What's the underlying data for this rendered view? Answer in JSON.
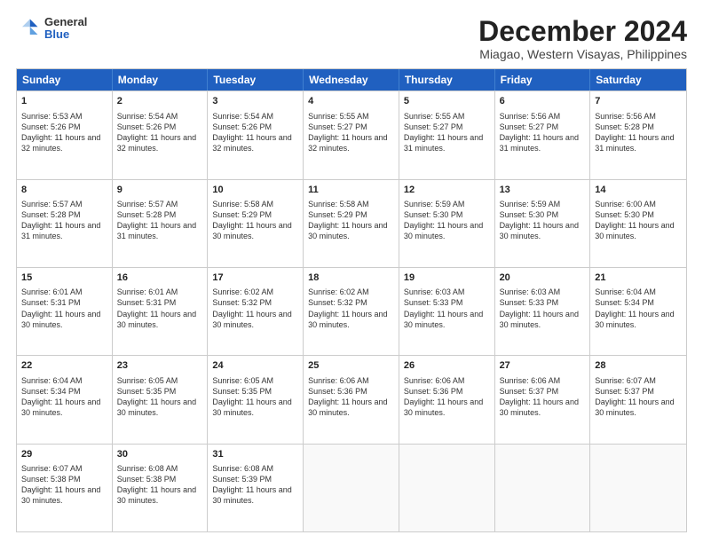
{
  "logo": {
    "general": "General",
    "blue": "Blue"
  },
  "title": "December 2024",
  "subtitle": "Miagao, Western Visayas, Philippines",
  "header_days": [
    "Sunday",
    "Monday",
    "Tuesday",
    "Wednesday",
    "Thursday",
    "Friday",
    "Saturday"
  ],
  "rows": [
    [
      {
        "day": "",
        "empty": true
      },
      {
        "day": "1",
        "sunrise": "Sunrise: 5:53 AM",
        "sunset": "Sunset: 5:26 PM",
        "daylight": "Daylight: 11 hours and 32 minutes."
      },
      {
        "day": "2",
        "sunrise": "Sunrise: 5:54 AM",
        "sunset": "Sunset: 5:26 PM",
        "daylight": "Daylight: 11 hours and 32 minutes."
      },
      {
        "day": "3",
        "sunrise": "Sunrise: 5:54 AM",
        "sunset": "Sunset: 5:26 PM",
        "daylight": "Daylight: 11 hours and 32 minutes."
      },
      {
        "day": "4",
        "sunrise": "Sunrise: 5:55 AM",
        "sunset": "Sunset: 5:27 PM",
        "daylight": "Daylight: 11 hours and 32 minutes."
      },
      {
        "day": "5",
        "sunrise": "Sunrise: 5:55 AM",
        "sunset": "Sunset: 5:27 PM",
        "daylight": "Daylight: 11 hours and 31 minutes."
      },
      {
        "day": "6",
        "sunrise": "Sunrise: 5:56 AM",
        "sunset": "Sunset: 5:27 PM",
        "daylight": "Daylight: 11 hours and 31 minutes."
      },
      {
        "day": "7",
        "sunrise": "Sunrise: 5:56 AM",
        "sunset": "Sunset: 5:28 PM",
        "daylight": "Daylight: 11 hours and 31 minutes."
      }
    ],
    [
      {
        "day": "8",
        "sunrise": "Sunrise: 5:57 AM",
        "sunset": "Sunset: 5:28 PM",
        "daylight": "Daylight: 11 hours and 31 minutes."
      },
      {
        "day": "9",
        "sunrise": "Sunrise: 5:57 AM",
        "sunset": "Sunset: 5:28 PM",
        "daylight": "Daylight: 11 hours and 31 minutes."
      },
      {
        "day": "10",
        "sunrise": "Sunrise: 5:58 AM",
        "sunset": "Sunset: 5:29 PM",
        "daylight": "Daylight: 11 hours and 30 minutes."
      },
      {
        "day": "11",
        "sunrise": "Sunrise: 5:58 AM",
        "sunset": "Sunset: 5:29 PM",
        "daylight": "Daylight: 11 hours and 30 minutes."
      },
      {
        "day": "12",
        "sunrise": "Sunrise: 5:59 AM",
        "sunset": "Sunset: 5:30 PM",
        "daylight": "Daylight: 11 hours and 30 minutes."
      },
      {
        "day": "13",
        "sunrise": "Sunrise: 5:59 AM",
        "sunset": "Sunset: 5:30 PM",
        "daylight": "Daylight: 11 hours and 30 minutes."
      },
      {
        "day": "14",
        "sunrise": "Sunrise: 6:00 AM",
        "sunset": "Sunset: 5:30 PM",
        "daylight": "Daylight: 11 hours and 30 minutes."
      }
    ],
    [
      {
        "day": "15",
        "sunrise": "Sunrise: 6:01 AM",
        "sunset": "Sunset: 5:31 PM",
        "daylight": "Daylight: 11 hours and 30 minutes."
      },
      {
        "day": "16",
        "sunrise": "Sunrise: 6:01 AM",
        "sunset": "Sunset: 5:31 PM",
        "daylight": "Daylight: 11 hours and 30 minutes."
      },
      {
        "day": "17",
        "sunrise": "Sunrise: 6:02 AM",
        "sunset": "Sunset: 5:32 PM",
        "daylight": "Daylight: 11 hours and 30 minutes."
      },
      {
        "day": "18",
        "sunrise": "Sunrise: 6:02 AM",
        "sunset": "Sunset: 5:32 PM",
        "daylight": "Daylight: 11 hours and 30 minutes."
      },
      {
        "day": "19",
        "sunrise": "Sunrise: 6:03 AM",
        "sunset": "Sunset: 5:33 PM",
        "daylight": "Daylight: 11 hours and 30 minutes."
      },
      {
        "day": "20",
        "sunrise": "Sunrise: 6:03 AM",
        "sunset": "Sunset: 5:33 PM",
        "daylight": "Daylight: 11 hours and 30 minutes."
      },
      {
        "day": "21",
        "sunrise": "Sunrise: 6:04 AM",
        "sunset": "Sunset: 5:34 PM",
        "daylight": "Daylight: 11 hours and 30 minutes."
      }
    ],
    [
      {
        "day": "22",
        "sunrise": "Sunrise: 6:04 AM",
        "sunset": "Sunset: 5:34 PM",
        "daylight": "Daylight: 11 hours and 30 minutes."
      },
      {
        "day": "23",
        "sunrise": "Sunrise: 6:05 AM",
        "sunset": "Sunset: 5:35 PM",
        "daylight": "Daylight: 11 hours and 30 minutes."
      },
      {
        "day": "24",
        "sunrise": "Sunrise: 6:05 AM",
        "sunset": "Sunset: 5:35 PM",
        "daylight": "Daylight: 11 hours and 30 minutes."
      },
      {
        "day": "25",
        "sunrise": "Sunrise: 6:06 AM",
        "sunset": "Sunset: 5:36 PM",
        "daylight": "Daylight: 11 hours and 30 minutes."
      },
      {
        "day": "26",
        "sunrise": "Sunrise: 6:06 AM",
        "sunset": "Sunset: 5:36 PM",
        "daylight": "Daylight: 11 hours and 30 minutes."
      },
      {
        "day": "27",
        "sunrise": "Sunrise: 6:06 AM",
        "sunset": "Sunset: 5:37 PM",
        "daylight": "Daylight: 11 hours and 30 minutes."
      },
      {
        "day": "28",
        "sunrise": "Sunrise: 6:07 AM",
        "sunset": "Sunset: 5:37 PM",
        "daylight": "Daylight: 11 hours and 30 minutes."
      }
    ],
    [
      {
        "day": "29",
        "sunrise": "Sunrise: 6:07 AM",
        "sunset": "Sunset: 5:38 PM",
        "daylight": "Daylight: 11 hours and 30 minutes."
      },
      {
        "day": "30",
        "sunrise": "Sunrise: 6:08 AM",
        "sunset": "Sunset: 5:38 PM",
        "daylight": "Daylight: 11 hours and 30 minutes."
      },
      {
        "day": "31",
        "sunrise": "Sunrise: 6:08 AM",
        "sunset": "Sunset: 5:39 PM",
        "daylight": "Daylight: 11 hours and 30 minutes."
      },
      {
        "day": "",
        "empty": true
      },
      {
        "day": "",
        "empty": true
      },
      {
        "day": "",
        "empty": true
      },
      {
        "day": "",
        "empty": true
      }
    ]
  ]
}
